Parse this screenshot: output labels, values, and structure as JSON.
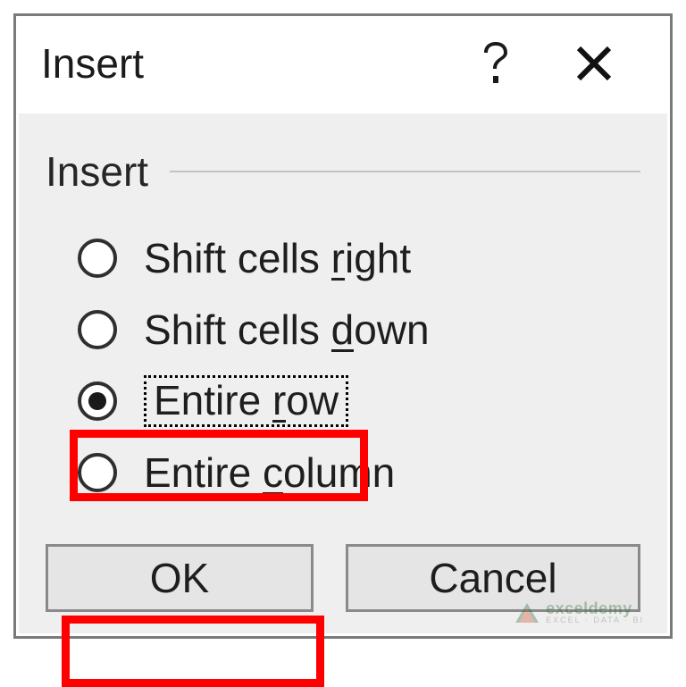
{
  "title": "Insert",
  "group_label": "Insert",
  "options": [
    {
      "pre": "Shift cells ",
      "accel": "r",
      "post": "ight",
      "selected": false
    },
    {
      "pre": "Shift cells ",
      "accel": "d",
      "post": "own",
      "selected": false
    },
    {
      "pre": "Entire ",
      "accel": "r",
      "post": "ow",
      "selected": true
    },
    {
      "pre": "Entire ",
      "accel": "c",
      "post": "olumn",
      "selected": false
    }
  ],
  "buttons": {
    "ok": "OK",
    "cancel": "Cancel"
  },
  "watermark": {
    "brand": "exceldemy",
    "tag": "EXCEL · DATA · BI"
  }
}
